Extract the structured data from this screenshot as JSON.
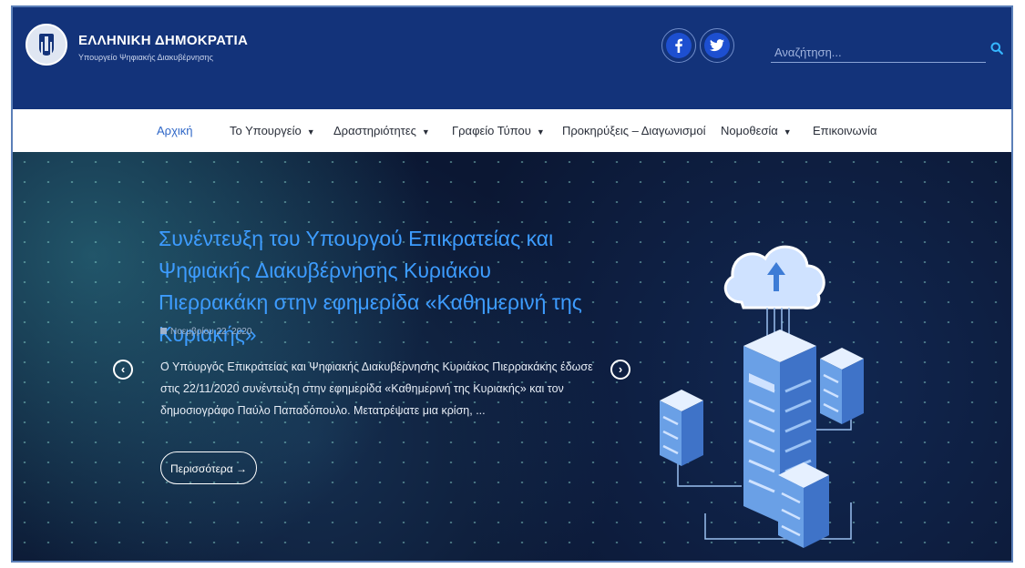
{
  "header": {
    "brand_title": "ΕΛΛΗΝΙΚΗ ΔΗΜΟΚΡΑΤΙΑ",
    "brand_subtitle": "Υπουργείο Ψηφιακής Διακυβέρνησης",
    "social": [
      {
        "name": "facebook-icon",
        "glyph": "f"
      },
      {
        "name": "twitter-icon",
        "glyph": "t"
      }
    ],
    "search": {
      "value": "",
      "placeholder": "Αναζήτηση..."
    }
  },
  "nav": {
    "items": [
      {
        "label": "Αρχική",
        "active": true,
        "dropdown": false
      },
      {
        "label": "Το Υπουργείο",
        "active": false,
        "dropdown": true
      },
      {
        "label": "Δραστηριότητες",
        "active": false,
        "dropdown": true
      },
      {
        "label": "Γραφείο Τύπου",
        "active": false,
        "dropdown": true
      },
      {
        "label": "Προκηρύξεις – Διαγωνισμοί",
        "active": false,
        "dropdown": false
      },
      {
        "label": "Νομοθεσία",
        "active": false,
        "dropdown": true
      },
      {
        "label": "Επικοινωνία",
        "active": false,
        "dropdown": false
      }
    ],
    "caret": "▼"
  },
  "hero": {
    "title": "Συνέντευξη του Υπουργού Επικρατείας και Ψηφιακής Διακυβέρνησης Κυριάκου Πιερρακάκη στην εφημερίδα «Καθημερινή της Κυριακής»",
    "date": "Νοεμβρίου 22, 2020",
    "excerpt": "Ο Υπουργός Επικρατείας και Ψηφιακής Διακυβέρνησης Κυριάκος Πιερρακάκης έδωσε στις 22/11/2020 συνέντευξη στην εφημερίδα «Καθημερινή της Κυριακής» και τον δημοσιογράφο Παύλο Παπαδόπουλο. Μετατρέψατε μια κρίση, ...",
    "more_label": "Περισσότερα →",
    "prev_glyph": "‹",
    "next_glyph": "›"
  },
  "colors": {
    "header_bg": "#13337a",
    "nav_bg": "#ffffff",
    "nav_active": "#2e66c7",
    "hero_bg": "#0b1733",
    "hero_title": "#3d9cff",
    "social_accent": "#1d4fd0"
  }
}
